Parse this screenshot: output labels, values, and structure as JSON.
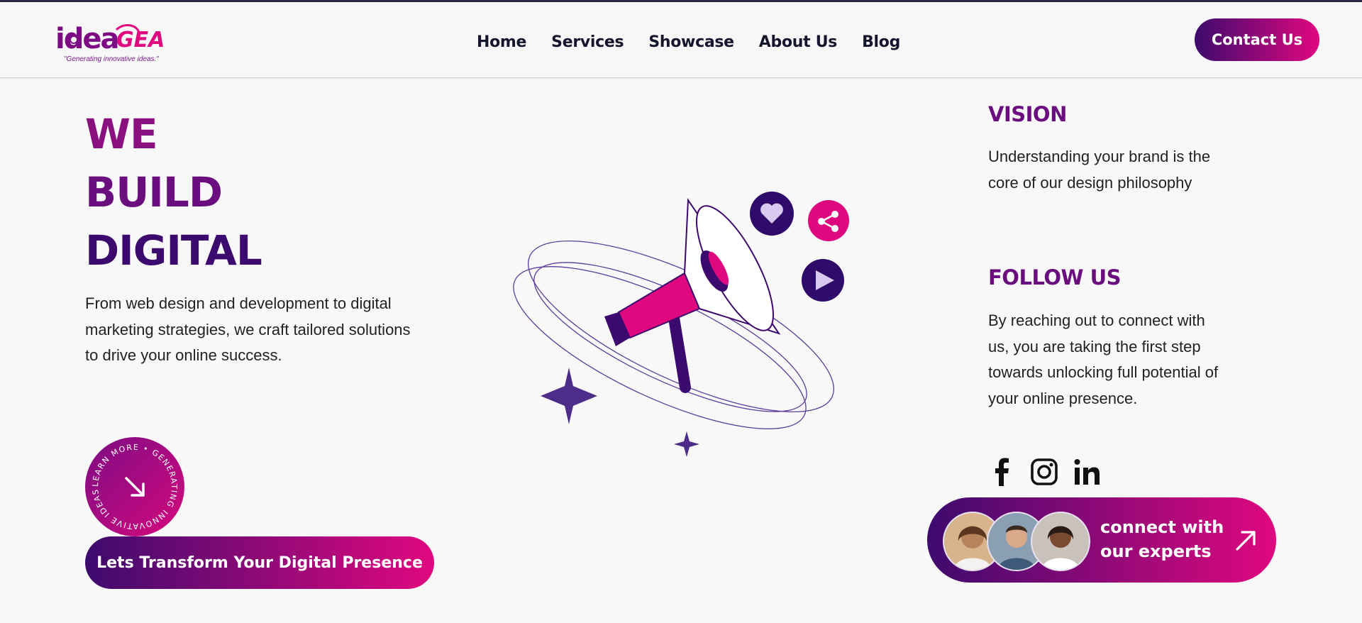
{
  "header": {
    "logo_text": "ideaGEA",
    "logo_tagline": "\"Generating innovative ideas.\"",
    "nav": [
      "Home",
      "Services",
      "Showcase",
      "About Us",
      "Blog"
    ],
    "contact_label": "Contact Us"
  },
  "hero": {
    "title_lines": [
      "WE",
      "BUILD",
      "DIGITAL"
    ],
    "description": "From web design and development to digital marketing strategies, we craft tailored solutions to drive your online success.",
    "badge_text": "LEARN MORE • GENERATING INNOVATIVE IDEAS •",
    "cta_label": "Lets Transform Your Digital Presence"
  },
  "vision": {
    "heading": "VISION",
    "text": "Understanding your brand is the core of our design philosophy"
  },
  "follow": {
    "heading": "FOLLOW US",
    "text": "By reaching out to connect with us, you are taking the first step towards unlocking full potential of your online presence.",
    "social_icons": [
      "facebook-icon",
      "instagram-icon",
      "linkedin-icon"
    ]
  },
  "experts": {
    "label_line1": "connect with",
    "label_line2": "our experts"
  },
  "colors": {
    "brand_purple": "#3d0a6e",
    "brand_magenta": "#e0087f",
    "title_purple": "#6a0d7e"
  }
}
